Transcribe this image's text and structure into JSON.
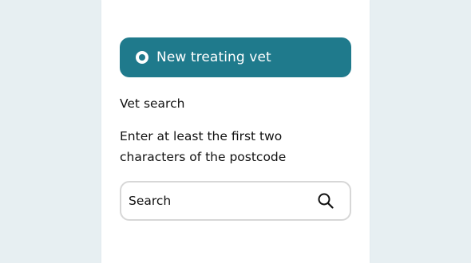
{
  "option": {
    "label": "New treating vet",
    "selected": true,
    "background_color": "#1f7a8c",
    "indicator_color": "#1f7a8c"
  },
  "vet_search": {
    "section_label": "Vet search",
    "hint": "Enter at least the first two characters of the postcode",
    "search": {
      "placeholder": "Search",
      "value": "",
      "icon": "search-icon"
    }
  }
}
